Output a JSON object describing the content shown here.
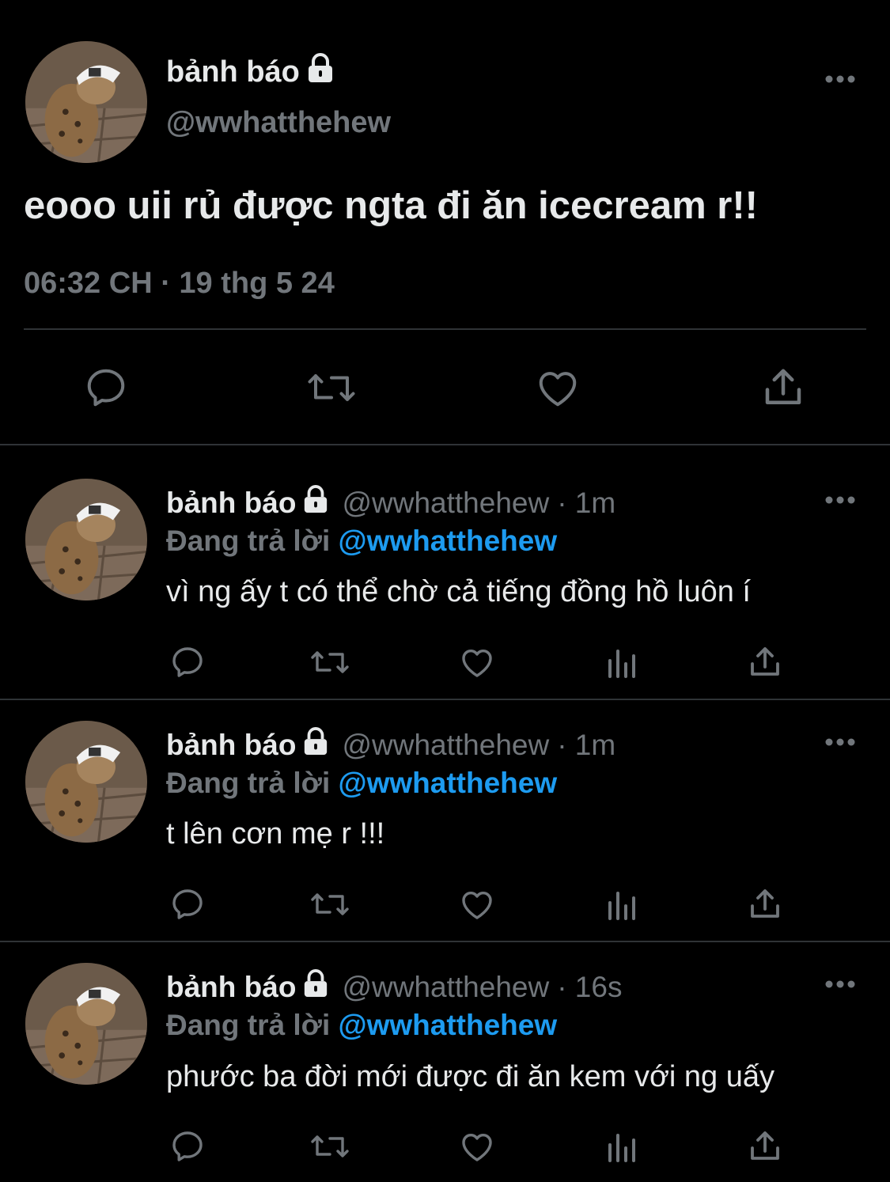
{
  "main_tweet": {
    "display_name": "bảnh báo",
    "handle": "@wwhatthehew",
    "text": "eooo uii rủ được ngta đi ăn icecream r!!",
    "timestamp": "06:32 CH · 19 thg 5 24",
    "actions": [
      "reply-icon",
      "retweet-icon",
      "like-icon",
      "share-icon"
    ]
  },
  "replies": [
    {
      "display_name": "bảnh báo",
      "handle": "@wwhatthehew",
      "time": "· 1m",
      "replying_prefix": "Đang trả lời",
      "replying_to": "@wwhatthehew",
      "text": "vì ng ấy t có thể chờ cả tiếng đồng hồ luôn í"
    },
    {
      "display_name": "bảnh báo",
      "handle": "@wwhatthehew",
      "time": "· 1m",
      "replying_prefix": "Đang trả lời",
      "replying_to": "@wwhatthehew",
      "text": "t lên cơn mẹ r !!!"
    },
    {
      "display_name": "bảnh báo",
      "handle": "@wwhatthehew",
      "time": "· 16s",
      "replying_prefix": "Đang trả lời",
      "replying_to": "@wwhatthehew",
      "text": "phước ba đời mới được đi ăn kem với ng uấy"
    }
  ],
  "colors": {
    "background": "#000000",
    "text": "#e7e9ea",
    "secondary": "#71767b",
    "accent": "#1d9bf0",
    "divider": "#2f3336"
  }
}
